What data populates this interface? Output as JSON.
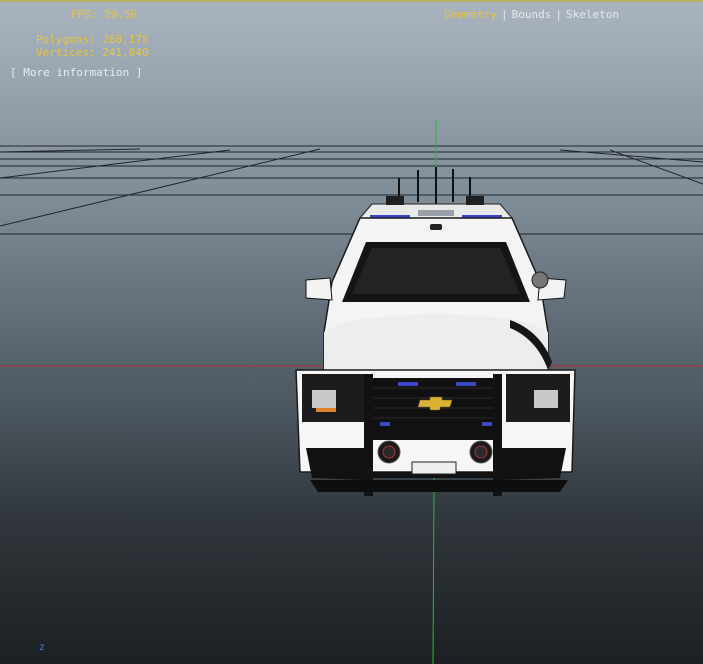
{
  "hud": {
    "fps_label": "FPS:",
    "fps_value": "29.56",
    "polygons_label": "Polygons:",
    "polygons_value": "268,175",
    "vertices_label": "Vertices:",
    "vertices_value": "241,040",
    "more_info": "[ More information ]"
  },
  "view_modes": {
    "items": [
      "Geometry",
      "Bounds",
      "Skeleton"
    ],
    "separator": "|",
    "active": "Geometry"
  },
  "axis": {
    "z_label": "z"
  },
  "colors": {
    "hud_text": "#e8c53a",
    "x_axis": "#c0262b",
    "y_axis": "#1fbf2b",
    "z_axis": "#3d7bd8",
    "grid": "#1e2329"
  }
}
